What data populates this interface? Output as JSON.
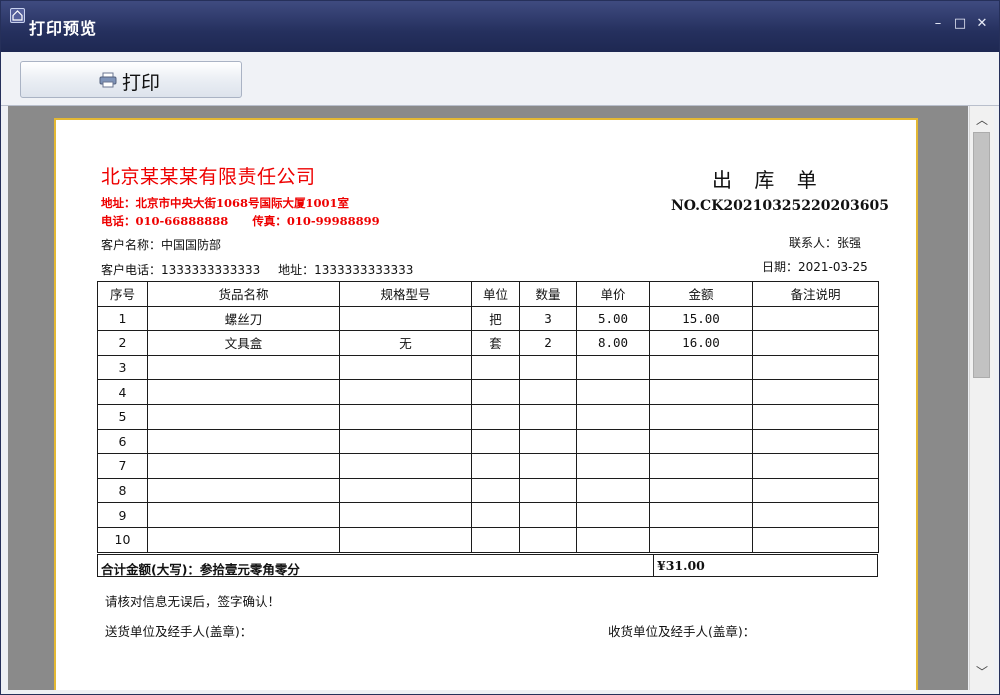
{
  "window": {
    "title": "打印预览",
    "controls": {
      "minimize": "–",
      "maximize": "□",
      "close": "✕"
    }
  },
  "toolbar": {
    "print_label": "打印",
    "print_icon": "printer-icon"
  },
  "document": {
    "company": {
      "name": "北京某某某有限责任公司",
      "address": "地址：北京市中央大街1068号国际大厦1001室",
      "phone_label": "电话：",
      "phone": "010-66888888",
      "fax_label": "传真：",
      "fax": "010-99988899"
    },
    "title": "出 库 单",
    "number": "NO.CK20210325220203605",
    "customer_name_label": "客户名称：",
    "customer_name": "中国国防部",
    "customer_phone_label": "客户电话：",
    "customer_phone": "1333333333333",
    "address_label": "地址：",
    "address": "1333333333333",
    "contact_label": "联系人：",
    "contact": "张强",
    "date_label": "日期：",
    "date": "2021-03-25",
    "table": {
      "headers": [
        "序号",
        "货品名称",
        "规格型号",
        "单位",
        "数量",
        "单价",
        "金额",
        "备注说明"
      ],
      "rows": [
        [
          "1",
          "螺丝刀",
          "",
          "把",
          "3",
          "5.00",
          "15.00",
          ""
        ],
        [
          "2",
          "文具盒",
          "无",
          "套",
          "2",
          "8.00",
          "16.00",
          ""
        ],
        [
          "3",
          "",
          "",
          "",
          "",
          "",
          "",
          ""
        ],
        [
          "4",
          "",
          "",
          "",
          "",
          "",
          "",
          ""
        ],
        [
          "5",
          "",
          "",
          "",
          "",
          "",
          "",
          ""
        ],
        [
          "6",
          "",
          "",
          "",
          "",
          "",
          "",
          ""
        ],
        [
          "7",
          "",
          "",
          "",
          "",
          "",
          "",
          ""
        ],
        [
          "8",
          "",
          "",
          "",
          "",
          "",
          "",
          ""
        ],
        [
          "9",
          "",
          "",
          "",
          "",
          "",
          "",
          ""
        ],
        [
          "10",
          "",
          "",
          "",
          "",
          "",
          "",
          ""
        ]
      ]
    },
    "total_label": "合计金额(大写)：参拾壹元零角零分",
    "total_value": "¥31.00",
    "confirm_note": "请核对信息无误后，签字确认！",
    "sender_label": "送货单位及经手人(盖章)：",
    "receiver_label": "收货单位及经手人(盖章)："
  },
  "colors": {
    "title_bar": "#25305e",
    "company_text": "#ee0000",
    "page_border": "#e3b834",
    "viewer_bg": "#8a8a8a"
  }
}
